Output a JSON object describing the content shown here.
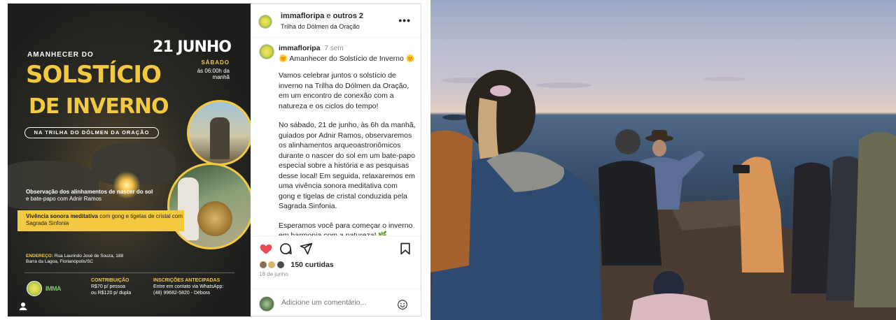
{
  "poster": {
    "date": "21 JUNHO",
    "day": "SÁBADO",
    "time": "às 06:00h da manhã",
    "kicker": "AMANHECER DO",
    "title_line1": "SOLSTÍCIO",
    "title_line2": "DE INVERNO",
    "subtitle_pill": "NA TRILHA DO DÓLMEN DA ORAÇÃO",
    "observation_bold": "Observação dos alinhamentos de nascer do sol",
    "observation_rest": "e bate-papo com Adnir Ramos",
    "band_bold": "Vivência sonora meditativa",
    "band_rest": "com gong e tigelas de cristal com Sagrada Sinfonia",
    "address_label": "ENDEREÇO:",
    "address_line1": "Rua Laurindo José de Souza, 188",
    "address_line2": "Barra da Lagoa, Florianópolis/SC",
    "logo2_text": "IMMA",
    "contrib_label": "CONTRIBUIÇÃO",
    "contrib_line1": "R$70 p/ pessoa",
    "contrib_line2": "ou R$120 p/ dupla",
    "insc_label": "INSCRIÇÕES ANTECIPADAS",
    "insc_line1": "Entre em contato via WhatsApp:",
    "insc_line2": "(48) 99682-5820 - Débora"
  },
  "header": {
    "user": "immafloripa",
    "connector": "e",
    "others": "outros 2",
    "location": "Trilha do Dólmen da Oração",
    "more_label": "•••"
  },
  "caption": {
    "user": "immafloripa",
    "age": "7 sem",
    "title": "🌞 Amanhecer do Solstício de Inverno 🌞",
    "paragraphs": [
      "Vamos celebrar juntos o solstício de inverno na Trilha do Dólmen da Oração, em um encontro de conexão com a natureza e os ciclos do tempo!",
      "No sábado, 21 de junho, às 6h da manhã, guiados por Adnir Ramos, observaremos os alinhamentos arqueoastronômicos durante o nascer do sol em um bate-papo especial sobre a história e as pesquisas desse local! Em seguida, relaxaremos em uma vivência sonora meditativa com gong e tigelas de cristal conduzida pela Sagrada Sinfonia.",
      "Esperamos você para começar o inverno em harmonia com a natureza! 🌿"
    ]
  },
  "engagement": {
    "likes": "150 curtidas",
    "date": "18 de junho"
  },
  "comment": {
    "placeholder": "Adicione um comentário..."
  },
  "colors": {
    "accent_yellow": "#f3c941",
    "like_red": "#ed4956",
    "text_dark": "#262626",
    "text_muted": "#8e8e8e"
  },
  "icons": {
    "like": "heart-icon",
    "comment": "comment-icon",
    "share": "paper-plane-icon",
    "save": "bookmark-icon",
    "emoji": "smiley-icon",
    "more": "more-dots-icon",
    "user_tag": "user-tag-icon"
  }
}
